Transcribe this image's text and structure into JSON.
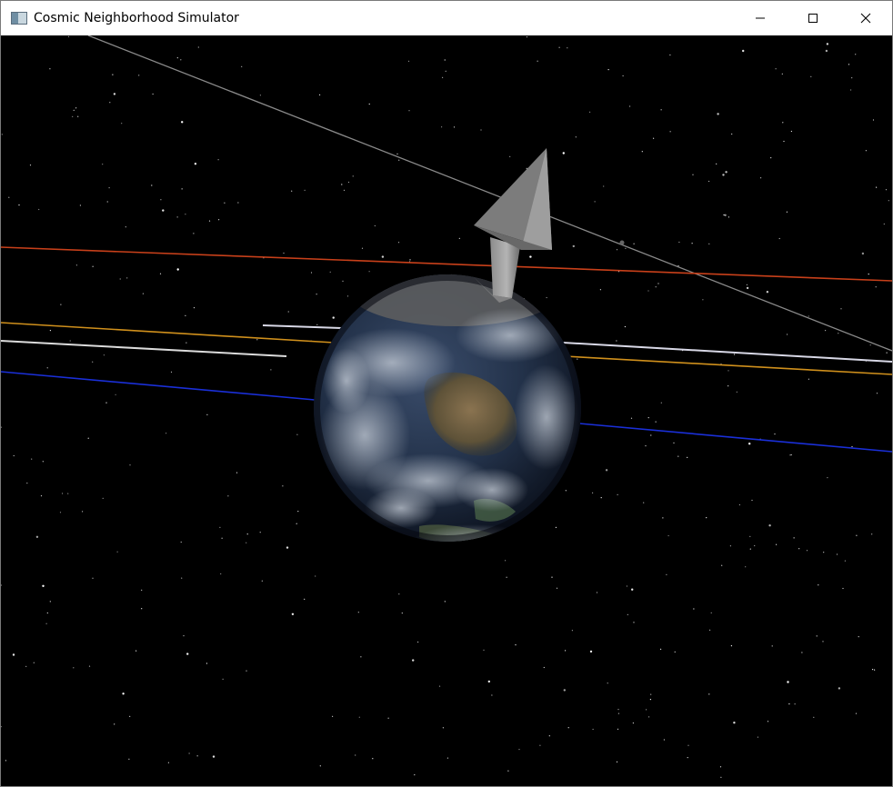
{
  "window": {
    "title": "Cosmic Neighborhood Simulator",
    "app_icon": "window-app-icon",
    "controls": {
      "minimize_icon": "minimize-icon",
      "maximize_icon": "maximize-icon",
      "close_icon": "close-icon"
    }
  },
  "scene": {
    "background_color": "#000000",
    "body": "earth-globe",
    "indicator": "direction-arrow",
    "orbit_colors": {
      "gray": "#8a8a8a",
      "red": "#c8401a",
      "white_upper": "#d8d8e6",
      "white_lower": "#dcdcdc",
      "orange": "#d0901c",
      "blue": "#1a2fd8"
    }
  }
}
